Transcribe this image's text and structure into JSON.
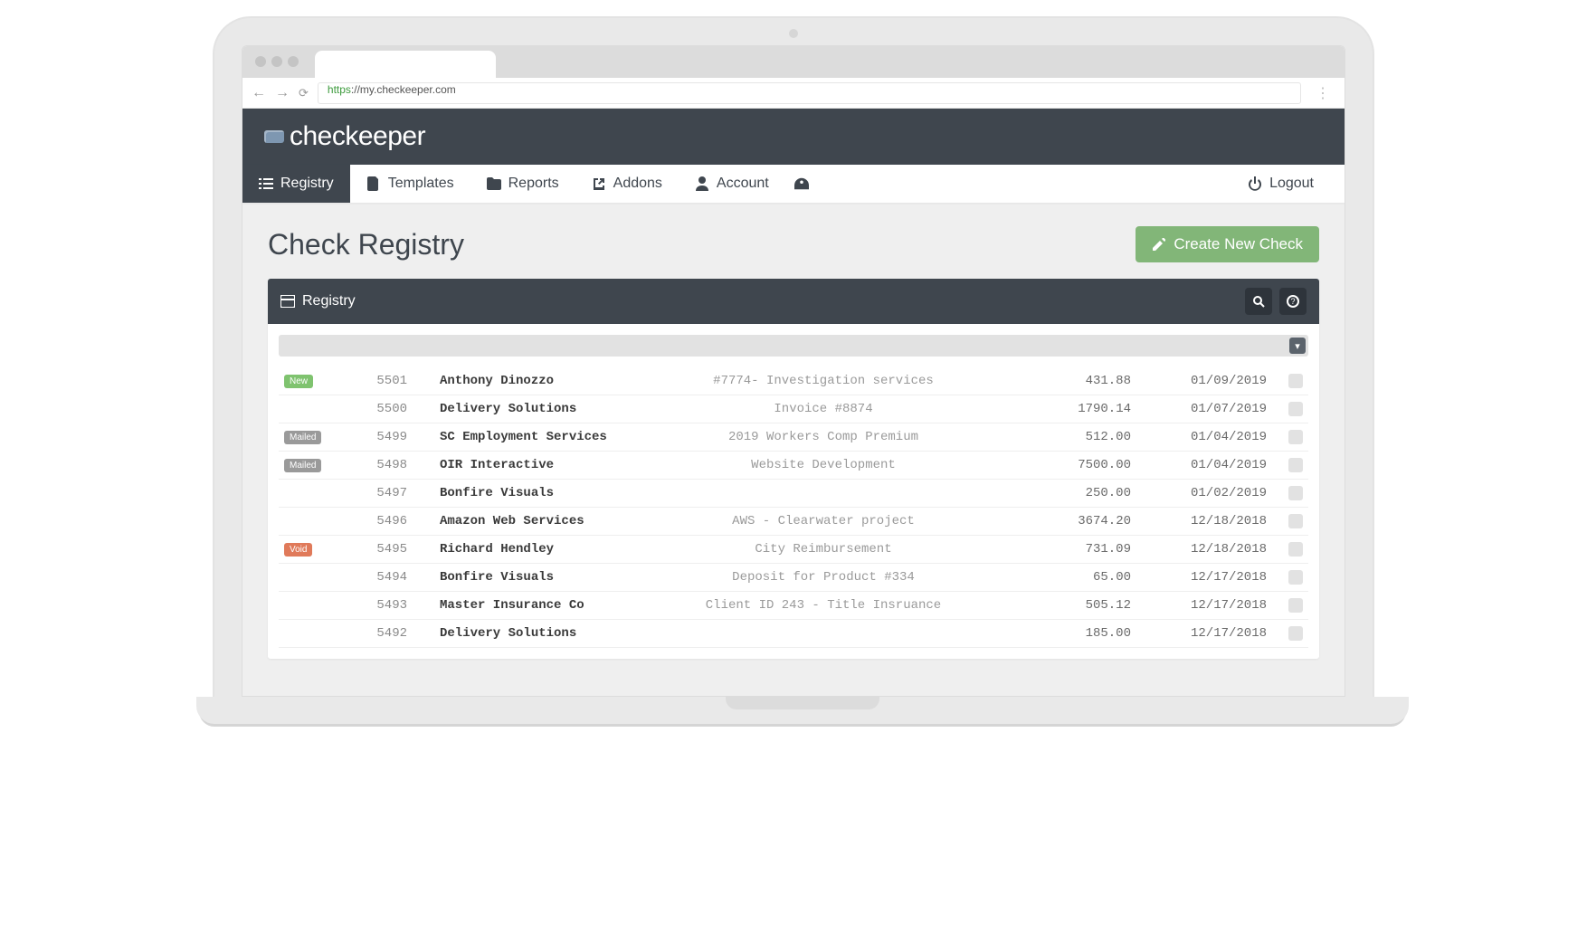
{
  "browser": {
    "url_prefix": "https",
    "url_rest": "://my.checkeeper.com"
  },
  "brand": "checkeeper",
  "nav": {
    "registry": "Registry",
    "templates": "Templates",
    "reports": "Reports",
    "addons": "Addons",
    "account": "Account",
    "logout": "Logout"
  },
  "page": {
    "title": "Check Registry",
    "create_label": "Create New Check",
    "panel_title": "Registry"
  },
  "status_labels": {
    "new": "New",
    "mailed": "Mailed",
    "void": "Void"
  },
  "checks": [
    {
      "status": "new",
      "num": "5501",
      "payee": "Anthony Dinozzo",
      "memo": "#7774- Investigation services",
      "amount": "431.88",
      "date": "01/09/2019"
    },
    {
      "status": "",
      "num": "5500",
      "payee": "Delivery Solutions",
      "memo": "Invoice #8874",
      "amount": "1790.14",
      "date": "01/07/2019"
    },
    {
      "status": "mailed",
      "num": "5499",
      "payee": "SC Employment Services",
      "memo": "2019 Workers Comp Premium",
      "amount": "512.00",
      "date": "01/04/2019"
    },
    {
      "status": "mailed",
      "num": "5498",
      "payee": "OIR Interactive",
      "memo": "Website Development",
      "amount": "7500.00",
      "date": "01/04/2019"
    },
    {
      "status": "",
      "num": "5497",
      "payee": "Bonfire Visuals",
      "memo": "",
      "amount": "250.00",
      "date": "01/02/2019"
    },
    {
      "status": "",
      "num": "5496",
      "payee": "Amazon Web Services",
      "memo": "AWS - Clearwater project",
      "amount": "3674.20",
      "date": "12/18/2018"
    },
    {
      "status": "void",
      "num": "5495",
      "payee": "Richard Hendley",
      "memo": "City Reimbursement",
      "amount": "731.09",
      "date": "12/18/2018"
    },
    {
      "status": "",
      "num": "5494",
      "payee": "Bonfire Visuals",
      "memo": "Deposit for Product #334",
      "amount": "65.00",
      "date": "12/17/2018"
    },
    {
      "status": "",
      "num": "5493",
      "payee": "Master Insurance Co",
      "memo": "Client ID 243 - Title Insruance",
      "amount": "505.12",
      "date": "12/17/2018"
    },
    {
      "status": "",
      "num": "5492",
      "payee": "Delivery Solutions",
      "memo": "",
      "amount": "185.00",
      "date": "12/17/2018"
    }
  ]
}
